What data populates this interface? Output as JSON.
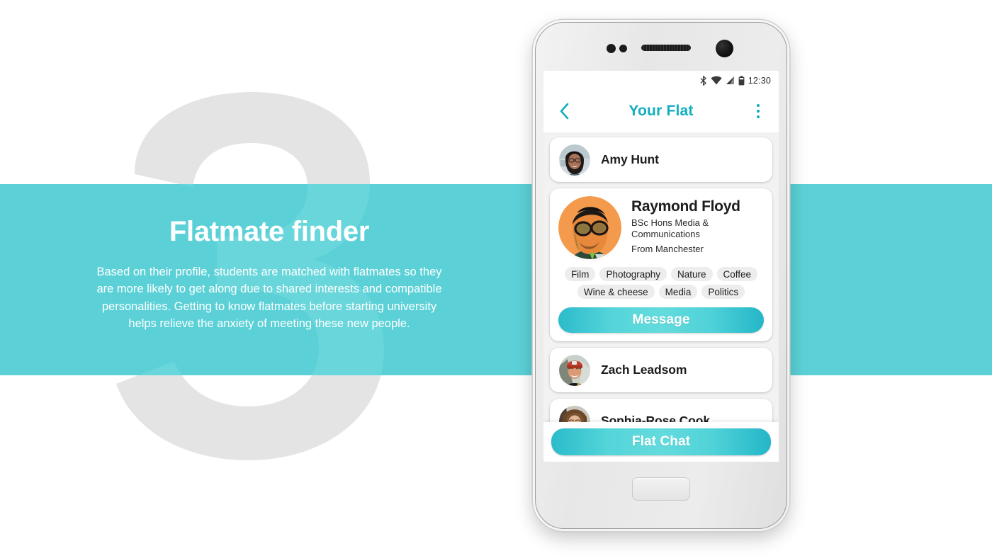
{
  "background": {
    "watermark_number": "3",
    "band_color": "#5BD1D7",
    "watermark_color": "#E4E4E4"
  },
  "left_panel": {
    "headline": "Flatmate finder",
    "body": "Based on their profile, students are matched with flatmates so they are more likely to get along due to shared interests and compatible personalities. Getting to know flatmates before starting university helps relieve the anxiety of meeting these new people."
  },
  "phone": {
    "status_bar": {
      "time": "12:30",
      "icons": [
        "bluetooth-icon",
        "wifi-icon",
        "signal-icon",
        "battery-icon"
      ]
    },
    "app_bar": {
      "back_icon": "back-chevron-icon",
      "title": "Your Flat",
      "overflow_icon": "overflow-menu-icon",
      "accent_color": "#12AEBF"
    },
    "flatmates": [
      {
        "name": "Amy Hunt",
        "avatar": "amy-hunt-avatar"
      },
      {
        "name": "Zach Leadsom",
        "avatar": "zach-leadsom-avatar"
      },
      {
        "name": "Sophia-Rose Cook",
        "avatar": "sophia-rose-cook-avatar"
      }
    ],
    "profile": {
      "name": "Raymond Floyd",
      "course": "BSc Hons Media & Communications",
      "origin": "From Manchester",
      "avatar": "raymond-floyd-avatar",
      "tags": [
        "Film",
        "Photography",
        "Nature",
        "Coffee",
        "Wine & cheese",
        "Media",
        "Politics"
      ],
      "message_label": "Message"
    },
    "bottom_bar": {
      "flat_chat_label": "Flat Chat"
    }
  }
}
